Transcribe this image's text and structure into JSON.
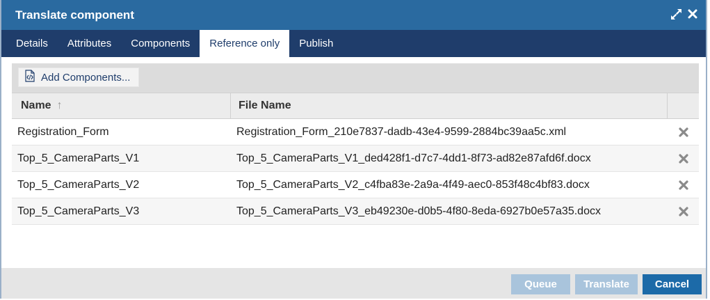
{
  "dialog": {
    "title": "Translate component"
  },
  "tabs": [
    {
      "label": "Details",
      "active": false
    },
    {
      "label": "Attributes",
      "active": false
    },
    {
      "label": "Components",
      "active": false
    },
    {
      "label": "Reference only",
      "active": true
    },
    {
      "label": "Publish",
      "active": false
    }
  ],
  "toolbar": {
    "add_label": "Add Components..."
  },
  "table": {
    "columns": [
      "Name",
      "File Name"
    ],
    "sort_indicator": "↑",
    "rows": [
      {
        "name": "Registration_Form",
        "file": "Registration_Form_210e7837-dadb-43e4-9599-2884bc39aa5c.xml"
      },
      {
        "name": "Top_5_CameraParts_V1",
        "file": "Top_5_CameraParts_V1_ded428f1-d7c7-4dd1-8f73-ad82e87afd6f.docx"
      },
      {
        "name": "Top_5_CameraParts_V2",
        "file": "Top_5_CameraParts_V2_c4fba83e-2a9a-4f49-aec0-853f48c4bf83.docx"
      },
      {
        "name": "Top_5_CameraParts_V3",
        "file": "Top_5_CameraParts_V3_eb49230e-d0b5-4f80-8eda-6927b0e57a35.docx"
      }
    ]
  },
  "footer": {
    "queue_label": "Queue",
    "translate_label": "Translate",
    "cancel_label": "Cancel"
  },
  "colors": {
    "title_bar": "#2a6aa0",
    "tab_bar": "#1f3d6b",
    "primary_button": "#1c6aa8",
    "disabled_button": "#a9c4dc"
  },
  "icons": {
    "maximize": "expand-arrows-icon",
    "close": "close-icon",
    "add": "code-document-icon",
    "delete": "delete-x-icon"
  }
}
